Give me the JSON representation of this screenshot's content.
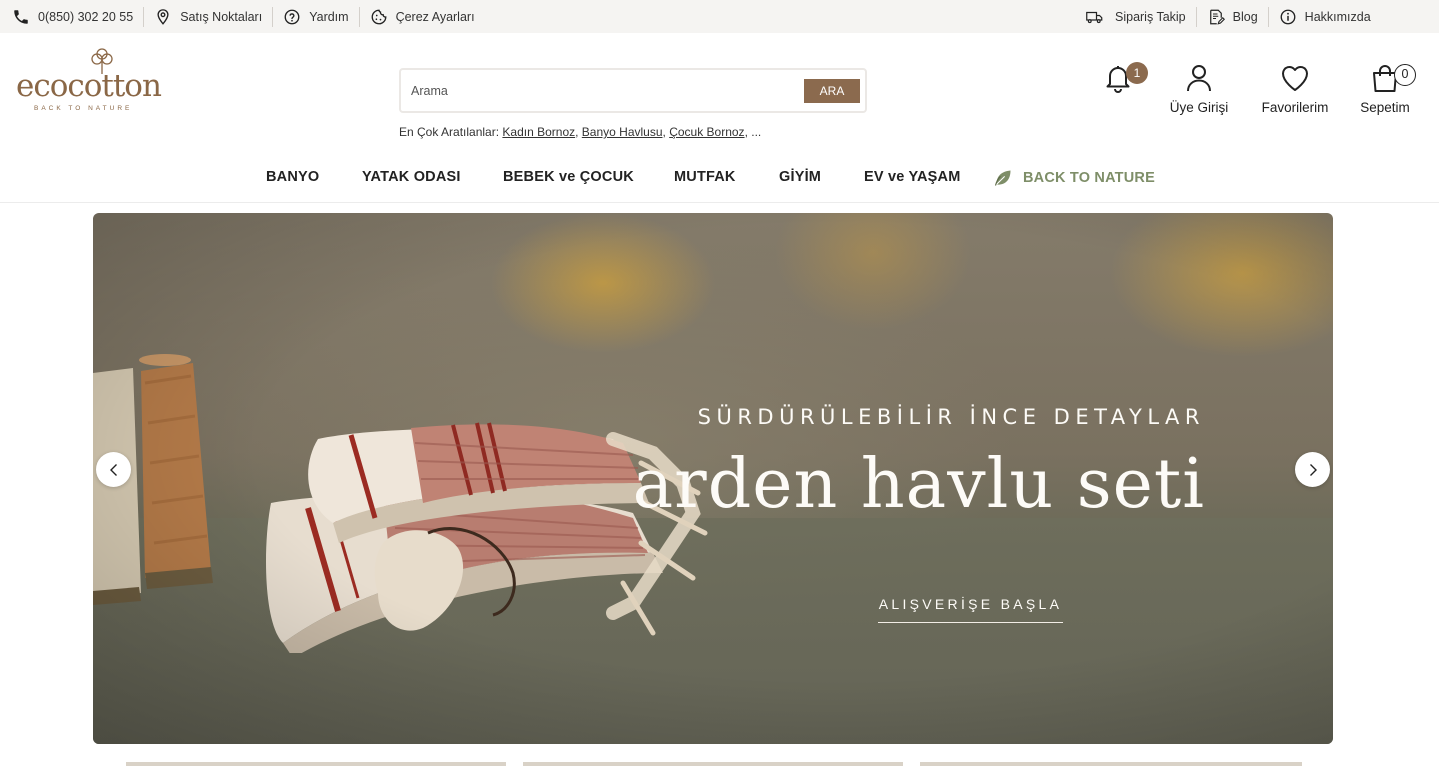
{
  "topbar": {
    "phone": "0(850) 302 20 55",
    "stores": "Satış Noktaları",
    "help": "Yardım",
    "cookies": "Çerez Ayarları",
    "order_tracking": "Sipariş Takip",
    "blog": "Blog",
    "about": "Hakkımızda"
  },
  "brand": {
    "logo_word": "ecocotton",
    "logo_tag": "BACK TO NATURE"
  },
  "search": {
    "placeholder": "Arama",
    "value": "",
    "button": "ARA",
    "popular_label": "En Çok Aratılanlar:",
    "popular": [
      "Kadın Bornoz",
      "Banyo Havlusu",
      "Çocuk Bornoz"
    ],
    "more": "..."
  },
  "header": {
    "notifications_count": "1",
    "login": "Üye Girişi",
    "favorites": "Favorilerim",
    "cart": "Sepetim",
    "cart_count": "0"
  },
  "nav": {
    "items": [
      "BANYO",
      "YATAK ODASI",
      "BEBEK ve ÇOCUK",
      "MUTFAK",
      "GİYİM",
      "EV ve YAŞAM"
    ],
    "special": "BACK TO NATURE"
  },
  "hero": {
    "pretitle": "SÜRDÜRÜLEBİLİR İNCE DETAYLAR",
    "title": "arden havlu seti",
    "cta": "ALIŞVERİŞE BAŞLA"
  },
  "colors": {
    "accent": "#8b6a4e",
    "brand": "#8a6746",
    "nature_green": "#7e8e68",
    "topbar_bg": "#f5f4f2"
  },
  "icons": {
    "phone": "phone-icon",
    "stores": "map-pin-icon",
    "help": "help-circle-icon",
    "cookies": "cookie-icon",
    "order_tracking": "truck-icon",
    "blog": "document-edit-icon",
    "about": "info-icon",
    "notifications": "bell-icon",
    "login": "user-icon",
    "favorites": "heart-icon",
    "cart": "shopping-bag-icon",
    "nature": "leaf-icon",
    "prev": "chevron-left-icon",
    "next": "chevron-right-icon"
  }
}
